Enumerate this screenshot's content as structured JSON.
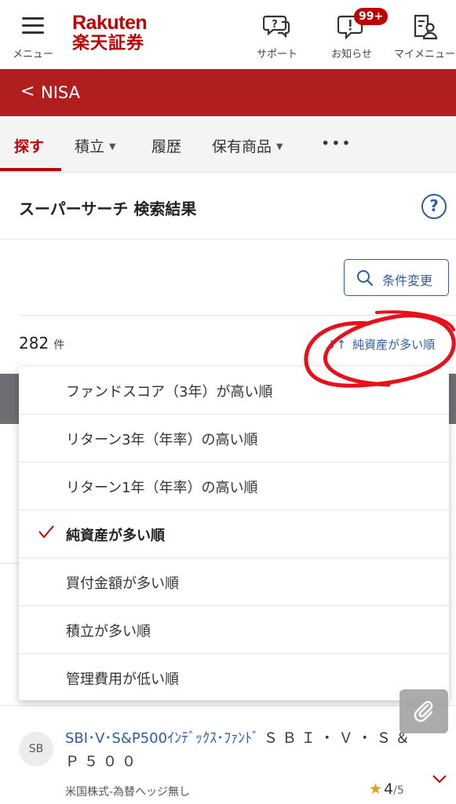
{
  "header": {
    "menu_label": "メニュー",
    "logo_line1": "Rakuten",
    "logo_line2": "楽天証券",
    "support_label": "サポート",
    "notice_label": "お知らせ",
    "notice_badge": "99+",
    "mymenu_label": "マイメニュー"
  },
  "nav": {
    "back_glyph": "<",
    "title": "NISA"
  },
  "tabs": [
    {
      "label": "探す"
    },
    {
      "label": "積立"
    },
    {
      "label": "履歴"
    },
    {
      "label": "保有商品"
    },
    {
      "label": "•••"
    }
  ],
  "tab_caret": "▼",
  "section": {
    "title": "スーパーサーチ 検索結果",
    "help_glyph": "?"
  },
  "search": {
    "condition_button": "条件変更"
  },
  "results": {
    "count": "282",
    "unit": "件",
    "sort_label": "純資産が多い順",
    "sort_glyph": "↓↑"
  },
  "sort_menu": {
    "items": [
      {
        "label": "ファンドスコア（3年）が高い順",
        "selected": false
      },
      {
        "label": "リターン3年（年率）の高い順",
        "selected": false
      },
      {
        "label": "リターン1年（年率）の高い順",
        "selected": false
      },
      {
        "label": "純資産が多い順",
        "selected": true
      },
      {
        "label": "買付金額が多い順",
        "selected": false
      },
      {
        "label": "積立が多い順",
        "selected": false
      },
      {
        "label": "管理費用が低い順",
        "selected": false
      }
    ]
  },
  "fund": {
    "avatar": "SB",
    "name_link": "SBI･V･S&P500ｲﾝﾃﾞｯｸｽ･ﾌｧﾝﾄﾞ",
    "name_rest": "ＳＢＩ・Ｖ・Ｓ＆Ｐ５００",
    "category": "米国株式-為替ヘッジ無し",
    "rating_value": "4",
    "rating_max": "/5",
    "star": "★"
  },
  "colors": {
    "brand_red": "#bf0000",
    "nav_red": "#b01e1e",
    "link_blue": "#2a5ca8",
    "annotation_red": "#e8101a"
  }
}
